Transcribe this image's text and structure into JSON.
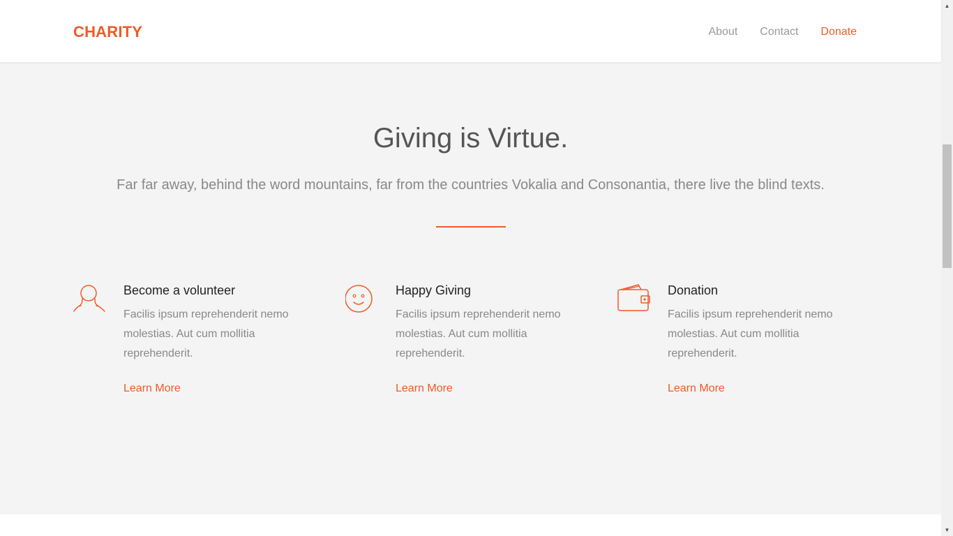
{
  "header": {
    "logo": "CHARITY",
    "nav": [
      {
        "label": "About",
        "active": false
      },
      {
        "label": "Contact",
        "active": false
      },
      {
        "label": "Donate",
        "active": true
      }
    ]
  },
  "hero": {
    "title": "Giving is Virtue.",
    "subtitle": "Far far away, behind the word mountains, far from the countries Vokalia and Consonantia, there live the blind texts."
  },
  "features": [
    {
      "icon": "user-icon",
      "title": "Become a volunteer",
      "text": "Facilis ipsum reprehenderit nemo molestias. Aut cum mollitia reprehenderit.",
      "link": "Learn More"
    },
    {
      "icon": "smiley-icon",
      "title": "Happy Giving",
      "text": "Facilis ipsum reprehenderit nemo molestias. Aut cum mollitia reprehenderit.",
      "link": "Learn More"
    },
    {
      "icon": "wallet-icon",
      "title": "Donation",
      "text": "Facilis ipsum reprehenderit nemo molestias. Aut cum mollitia reprehenderit.",
      "link": "Learn More"
    }
  ],
  "colors": {
    "accent": "#f05a28",
    "background": "#f4f4f4",
    "muted_text": "#888888"
  }
}
